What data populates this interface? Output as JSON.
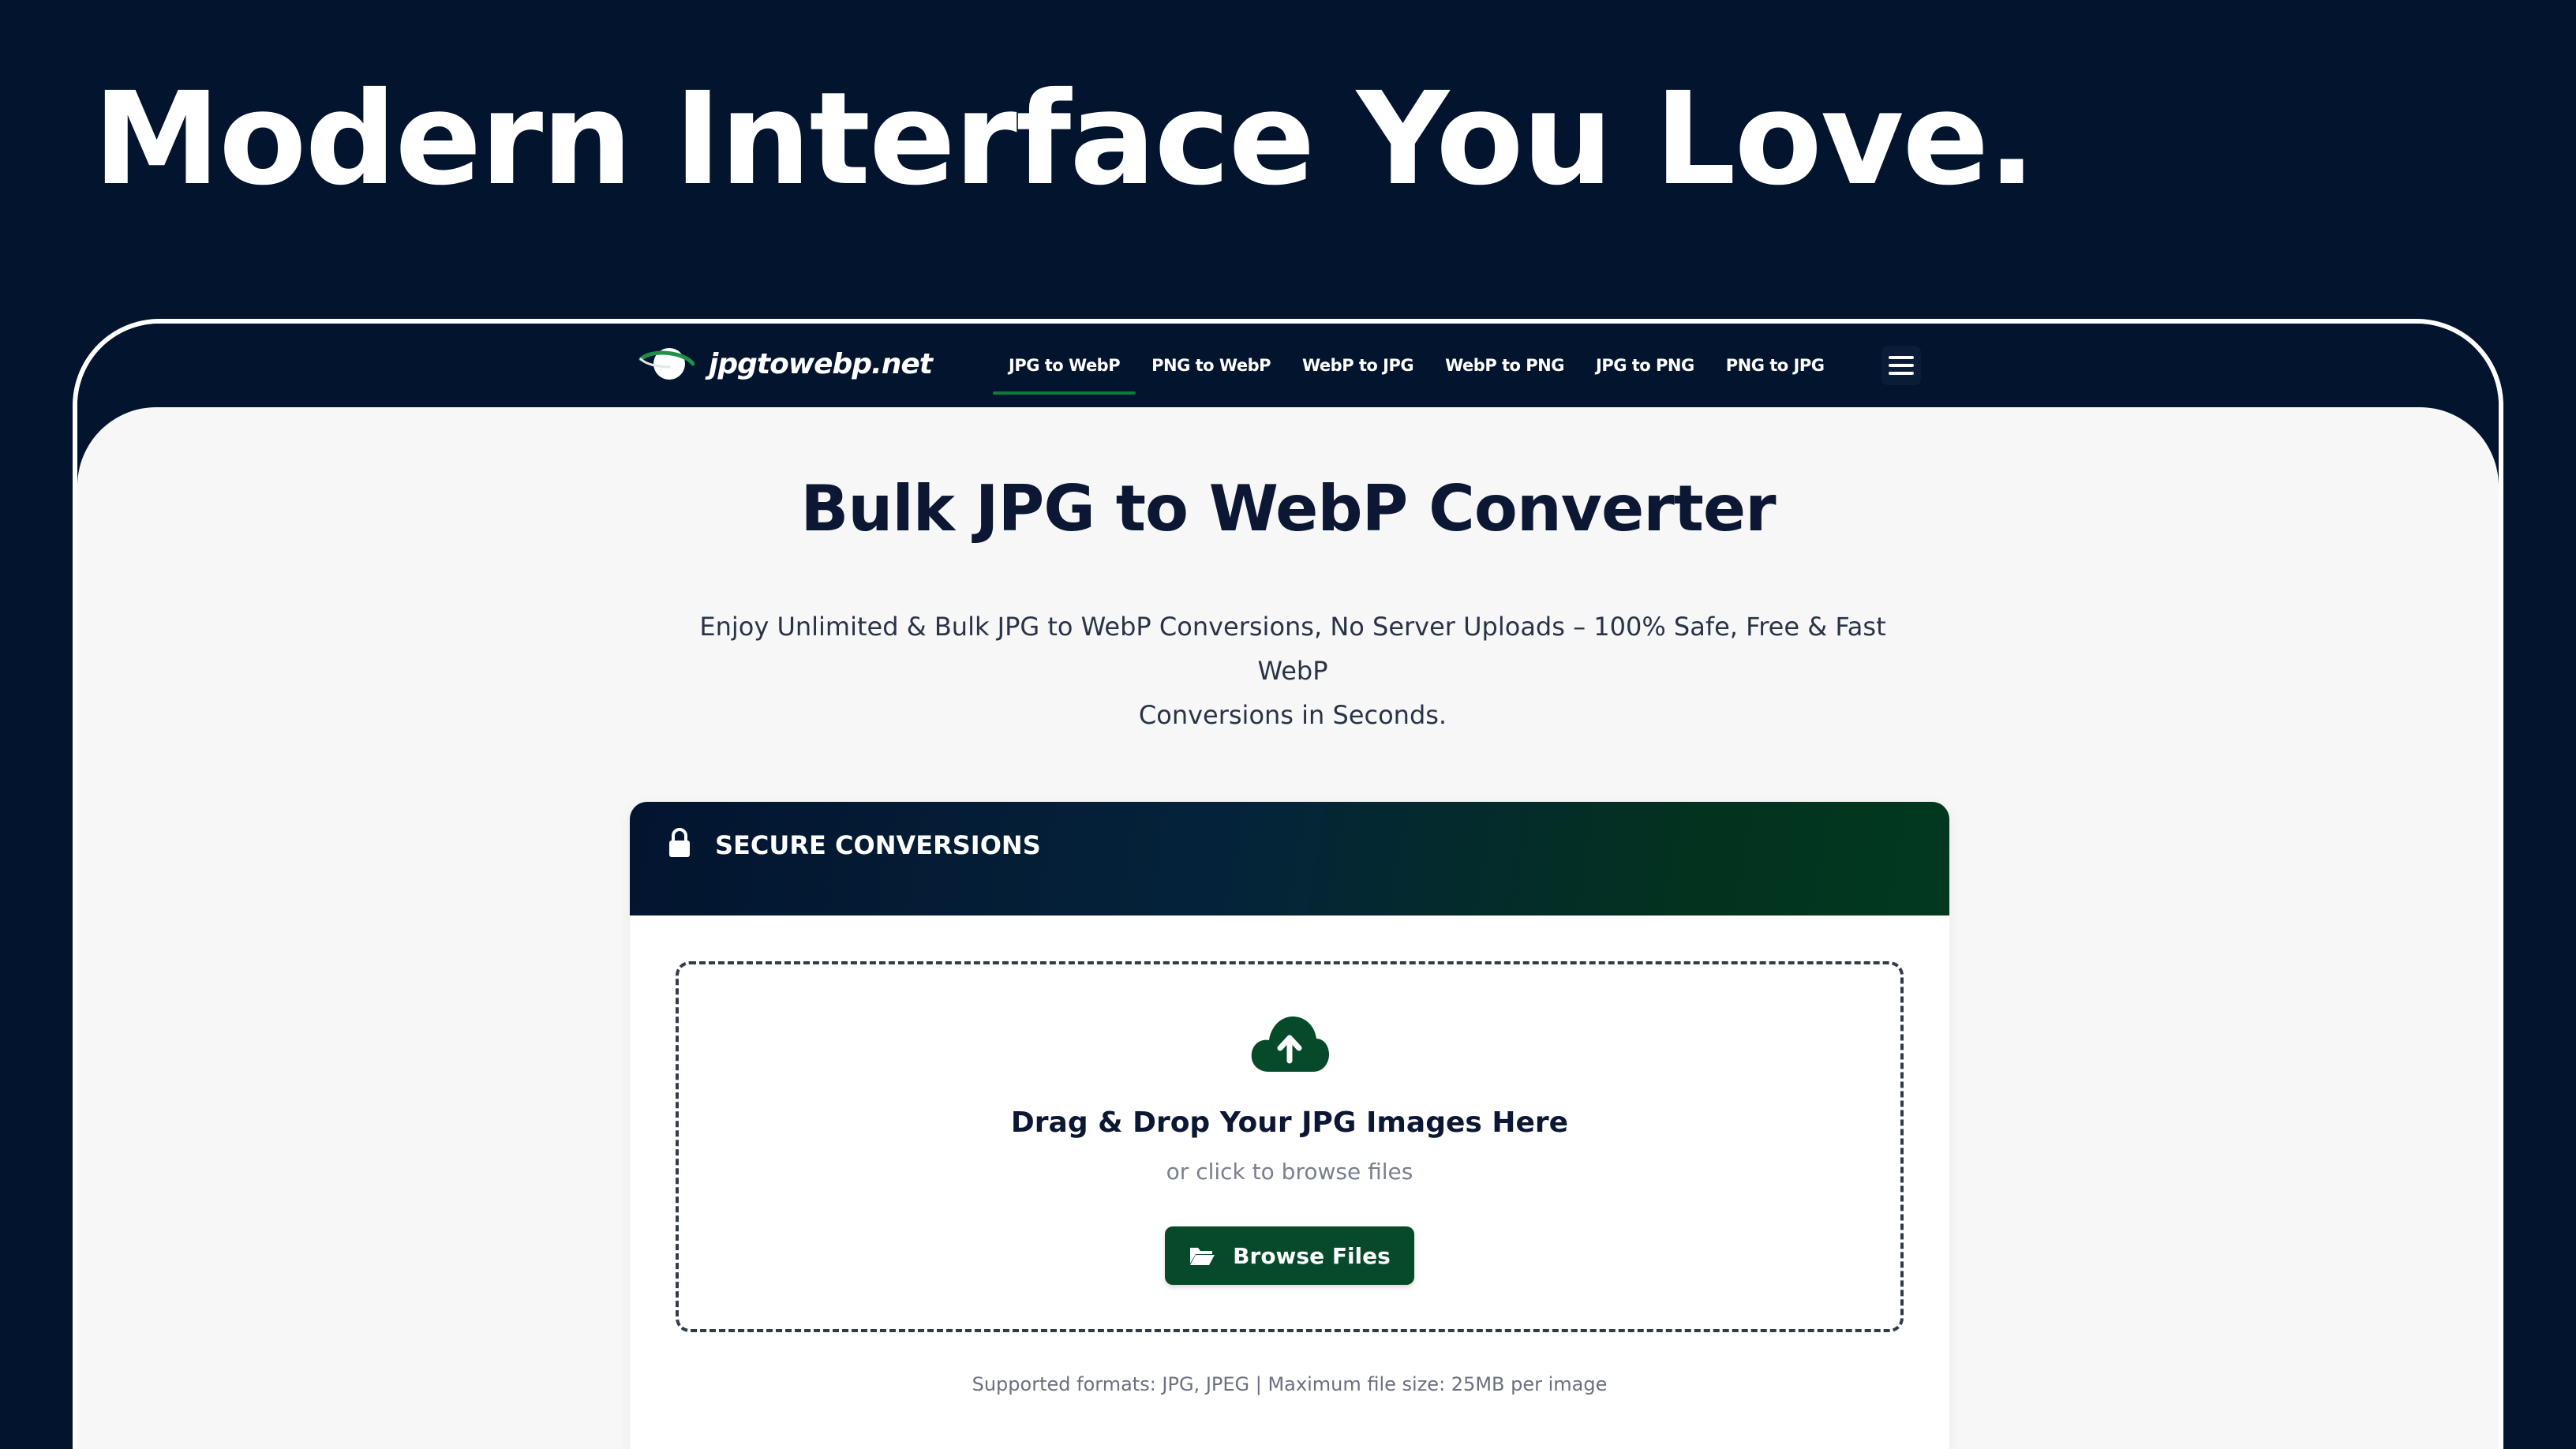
{
  "hero": {
    "title": "Modern Interface You Love."
  },
  "navbar": {
    "logo_text": "jpgtowebp.net",
    "links": [
      {
        "label": "JPG to WebP",
        "active": true
      },
      {
        "label": "PNG to WebP",
        "active": false
      },
      {
        "label": "WebP to JPG",
        "active": false
      },
      {
        "label": "WebP to PNG",
        "active": false
      },
      {
        "label": "JPG to PNG",
        "active": false
      },
      {
        "label": "PNG to JPG",
        "active": false
      }
    ],
    "menu_icon": "hamburger-menu-icon"
  },
  "main": {
    "title": "Bulk JPG to WebP Converter",
    "subtitle_line1": "Enjoy Unlimited & Bulk JPG to WebP Conversions, No Server Uploads – 100% Safe, Free & Fast WebP",
    "subtitle_line2": "Conversions in Seconds."
  },
  "card": {
    "header_icon": "lock-icon",
    "header_title": "SECURE CONVERSIONS",
    "dropzone": {
      "icon": "cloud-upload-icon",
      "title": "Drag & Drop Your JPG Images Here",
      "subtitle": "or click to browse files",
      "button_label": "Browse Files",
      "button_icon": "folder-open-icon"
    },
    "formats_note": "Supported formats: JPG, JPEG | Maximum file size: 25MB per image"
  },
  "colors": {
    "background": "#03142f",
    "content_bg": "#f7f7f8",
    "accent_green": "#064a2a",
    "title_dark": "#0b1733"
  }
}
